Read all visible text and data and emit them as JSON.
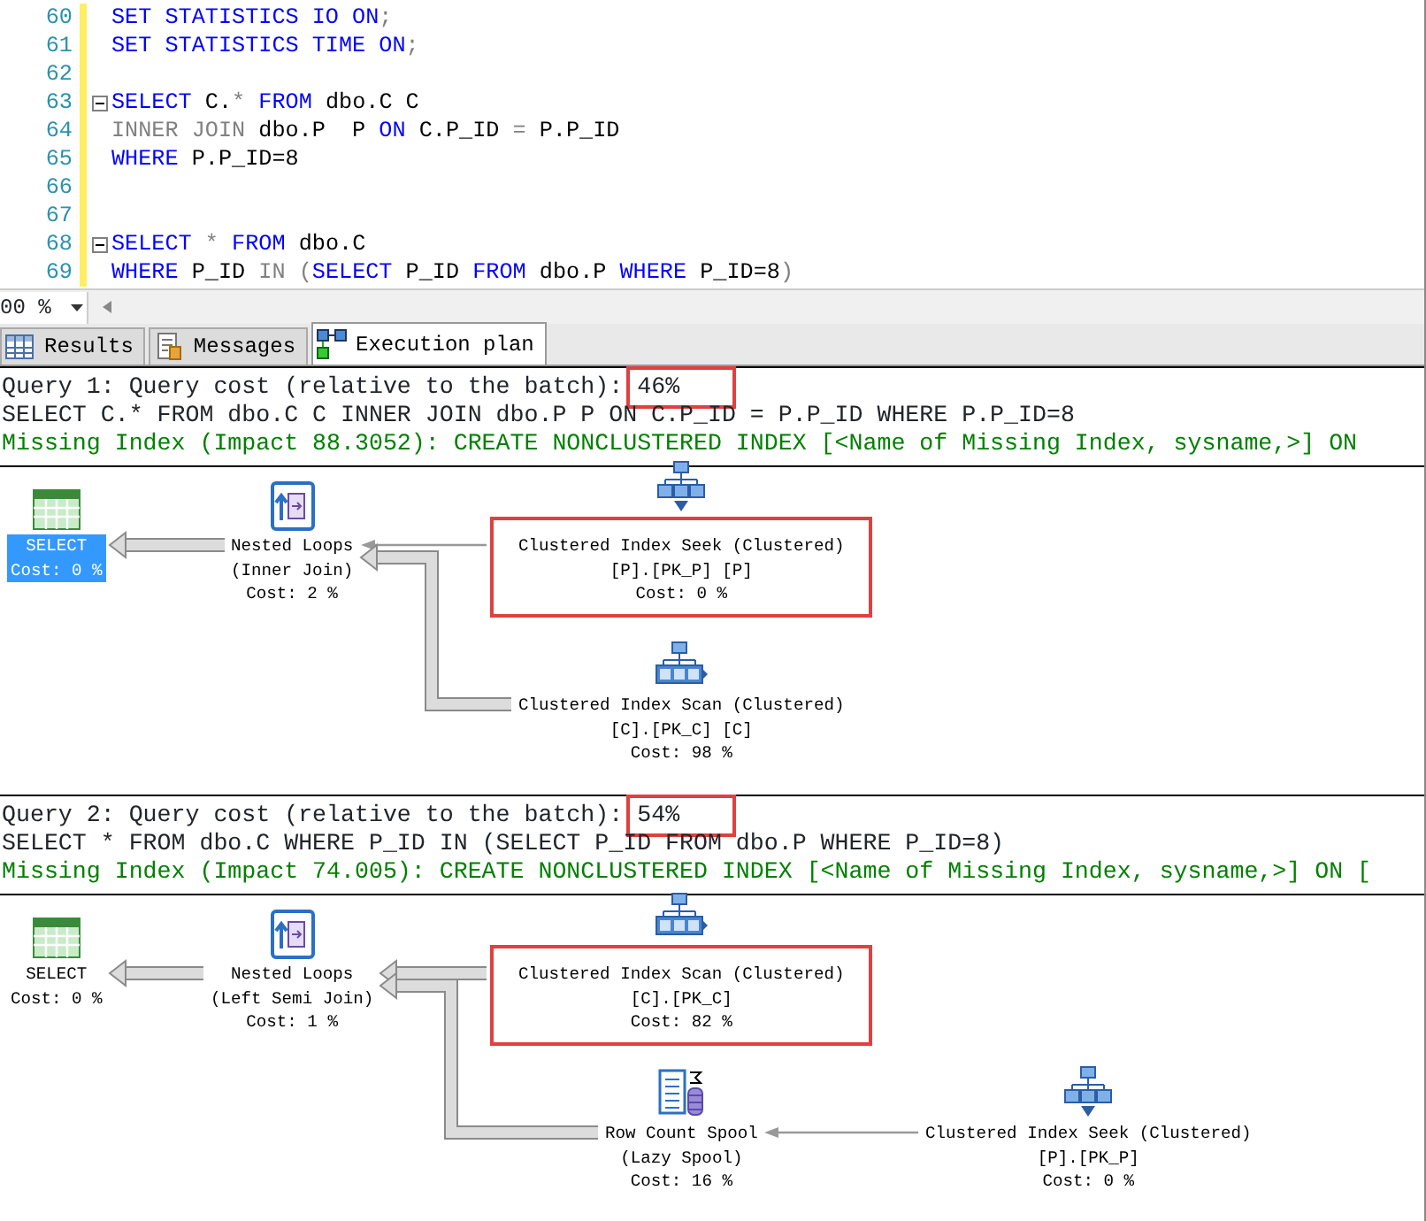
{
  "editor": {
    "lines": [
      {
        "number": "60",
        "collapsible": false,
        "tokens": [
          {
            "text": "SET STATISTICS IO ON",
            "kind": "keyword"
          },
          {
            "text": ";",
            "kind": "operator"
          }
        ]
      },
      {
        "number": "61",
        "collapsible": false,
        "tokens": [
          {
            "text": "SET STATISTICS TIME ON",
            "kind": "keyword"
          },
          {
            "text": ";",
            "kind": "operator"
          }
        ]
      },
      {
        "number": "62",
        "collapsible": false
      },
      {
        "number": "63",
        "collapsible": true,
        "tokens": [
          {
            "text": "SELECT",
            "kind": "keyword"
          },
          {
            "text": " C.",
            "kind": "plain"
          },
          {
            "text": "* ",
            "kind": "operator"
          },
          {
            "text": "FROM",
            "kind": "keyword"
          },
          {
            "text": " dbo.C C",
            "kind": "plain"
          }
        ]
      },
      {
        "number": "64",
        "collapsible": false,
        "tokens": [
          {
            "text": "INNER JOIN",
            "kind": "operator"
          },
          {
            "text": " dbo.P  P ",
            "kind": "plain"
          },
          {
            "text": "ON",
            "kind": "keyword"
          },
          {
            "text": " C.P_ID ",
            "kind": "plain"
          },
          {
            "text": "=",
            "kind": "operator"
          },
          {
            "text": " P.P_ID",
            "kind": "plain"
          }
        ]
      },
      {
        "number": "65",
        "collapsible": false,
        "tokens": [
          {
            "text": "WHERE",
            "kind": "keyword"
          },
          {
            "text": " P.P_ID=8",
            "kind": "plain"
          }
        ]
      },
      {
        "number": "66",
        "collapsible": false
      },
      {
        "number": "67",
        "collapsible": false
      },
      {
        "number": "68",
        "collapsible": true,
        "tokens": [
          {
            "text": "SELECT",
            "kind": "keyword"
          },
          {
            "text": " * ",
            "kind": "operator"
          },
          {
            "text": "FROM",
            "kind": "keyword"
          },
          {
            "text": " dbo.C",
            "kind": "plain"
          }
        ]
      },
      {
        "number": "69",
        "collapsible": false,
        "tokens": [
          {
            "text": "WHERE",
            "kind": "keyword"
          },
          {
            "text": " P_ID ",
            "kind": "plain"
          },
          {
            "text": "IN (",
            "kind": "operator"
          },
          {
            "text": "SELECT",
            "kind": "keyword"
          },
          {
            "text": " P_ID ",
            "kind": "plain"
          },
          {
            "text": "FROM",
            "kind": "keyword"
          },
          {
            "text": " dbo.P ",
            "kind": "plain"
          },
          {
            "text": "WHERE",
            "kind": "keyword"
          },
          {
            "text": " P_ID=8",
            "kind": "plain"
          },
          {
            "text": ")",
            "kind": "operator"
          }
        ]
      }
    ]
  },
  "zoom": {
    "value": "00 %"
  },
  "tabs": [
    {
      "label": "Results",
      "kind": "grid",
      "selected": false
    },
    {
      "label": "Messages",
      "kind": "messages",
      "selected": false
    },
    {
      "label": "Execution plan",
      "kind": "plan",
      "selected": true
    }
  ],
  "queries": [
    {
      "cost_label": "Query 1: Query cost (relative to the batch):",
      "cost": "46%",
      "cost_highlighted": true,
      "statement": "SELECT C.* FROM dbo.C C INNER JOIN dbo.P P ON C.P_ID = P.P_ID WHERE P.P_ID=8",
      "missing_index": "Missing Index (Impact 88.3052): CREATE NONCLUSTERED INDEX [<Name of Missing Index, sysname,>] ON",
      "plan": {
        "kind": "select",
        "lines": [
          "SELECT",
          "Cost: 0 %"
        ],
        "selected": true,
        "highlighted": false,
        "children": [
          {
            "kind": "nested_loops",
            "lines": [
              "Nested Loops",
              "(Inner Join)",
              "Cost: 2 %"
            ],
            "thick_arrow": true,
            "selected": false,
            "highlighted": false,
            "children": [
              {
                "kind": "index_seek",
                "lines": [
                  "Clustered Index Seek (Clustered)",
                  "[P].[PK_P] [P]",
                  "Cost: 0 %"
                ],
                "thick_arrow": false,
                "selected": false,
                "highlighted": true
              },
              {
                "kind": "index_scan",
                "lines": [
                  "Clustered Index Scan (Clustered)",
                  "[C].[PK_C] [C]",
                  "Cost: 98 %"
                ],
                "thick_arrow": true,
                "selected": false,
                "highlighted": false
              }
            ]
          }
        ]
      }
    },
    {
      "cost_label": "Query 2: Query cost (relative to the batch):",
      "cost": "54%",
      "cost_highlighted": true,
      "statement": "SELECT * FROM dbo.C WHERE P_ID IN (SELECT P_ID FROM dbo.P WHERE P_ID=8)",
      "missing_index": "Missing Index (Impact 74.005): CREATE NONCLUSTERED INDEX [<Name of Missing Index, sysname,>] ON [",
      "plan": {
        "kind": "select",
        "lines": [
          "SELECT",
          "Cost: 0 %"
        ],
        "selected": false,
        "highlighted": false,
        "children": [
          {
            "kind": "nested_loops",
            "lines": [
              "Nested Loops",
              "(Left Semi Join)",
              "Cost: 1 %"
            ],
            "thick_arrow": true,
            "selected": false,
            "highlighted": false,
            "children": [
              {
                "kind": "index_scan",
                "lines": [
                  "Clustered Index Scan (Clustered)",
                  "[C].[PK_C]",
                  "Cost: 82 %"
                ],
                "thick_arrow": true,
                "selected": false,
                "highlighted": true
              },
              {
                "kind": "spool",
                "lines": [
                  "Row Count Spool",
                  "(Lazy Spool)",
                  "Cost: 16 %"
                ],
                "thick_arrow": true,
                "selected": false,
                "highlighted": false,
                "children": [
                  {
                    "kind": "index_seek",
                    "lines": [
                      "Clustered Index Seek (Clustered)",
                      "[P].[PK_P]",
                      "Cost: 0 %"
                    ],
                    "thick_arrow": false,
                    "selected": false,
                    "highlighted": false
                  }
                ]
              }
            ]
          }
        ]
      }
    }
  ]
}
